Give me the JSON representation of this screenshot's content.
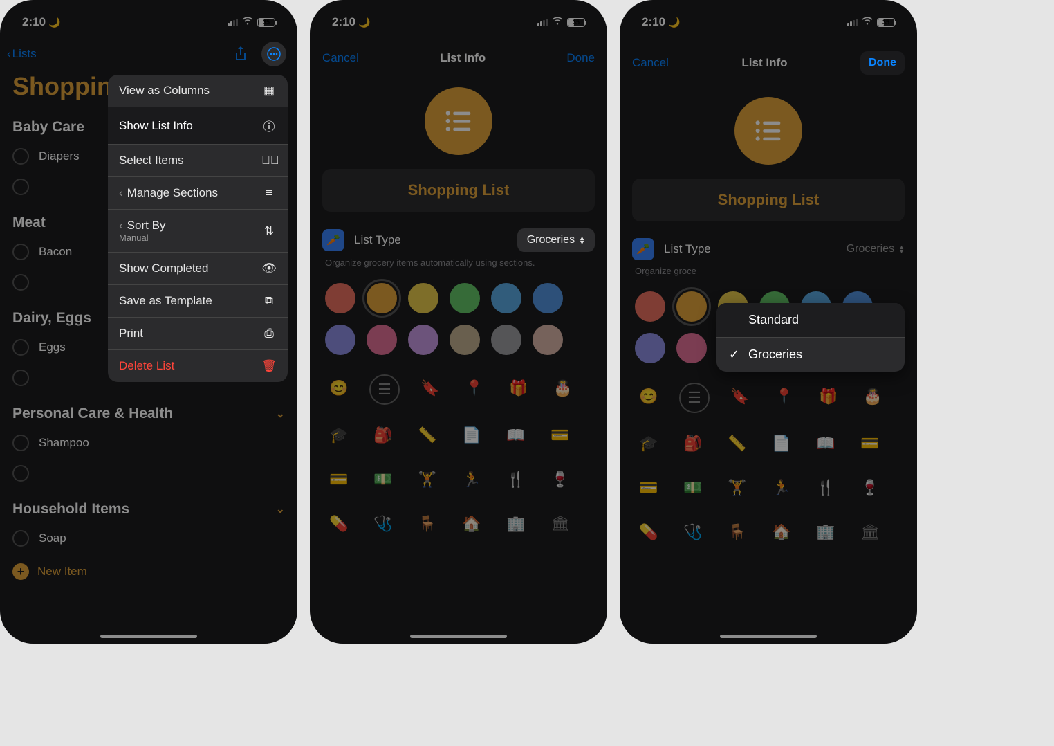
{
  "status": {
    "time": "2:10",
    "battery": "35"
  },
  "screen1": {
    "back": "Lists",
    "title": "Shoppin",
    "sections": [
      {
        "name": "Baby Care",
        "items": [
          "Diapers"
        ],
        "chevron": false
      },
      {
        "name": "Meat",
        "items": [
          "Bacon"
        ],
        "chevron": false
      },
      {
        "name": "Dairy, Eggs",
        "items": [
          "Eggs"
        ],
        "chevron": false
      },
      {
        "name": "Personal Care & Health",
        "items": [
          "Shampoo"
        ],
        "chevron": true
      },
      {
        "name": "Household Items",
        "items": [
          "Soap"
        ],
        "chevron": true
      }
    ],
    "newItem": "New Item",
    "menu": {
      "viewColumns": "View as Columns",
      "showListInfo": "Show List Info",
      "selectItems": "Select Items",
      "manageSections": "Manage Sections",
      "sortBy": "Sort By",
      "sortBySub": "Manual",
      "showCompleted": "Show Completed",
      "saveTemplate": "Save as Template",
      "print": "Print",
      "deleteList": "Delete List"
    }
  },
  "listInfo": {
    "cancel": "Cancel",
    "title": "List Info",
    "done": "Done",
    "listName": "Shopping List",
    "typeLabel": "List Type",
    "typeValue": "Groceries",
    "helpText": "Organize grocery items automatically using sections.",
    "colors": [
      "#e86f5f",
      "#e0a33b",
      "#e5c84c",
      "#63c466",
      "#5aa8e0",
      "#5393dd",
      "#8d8de0",
      "#e06f96",
      "#c598e0",
      "#c0ae8e",
      "#9b9b9f",
      "#d7b2a6"
    ],
    "dropdown": {
      "standard": "Standard",
      "groceries": "Groceries"
    }
  }
}
